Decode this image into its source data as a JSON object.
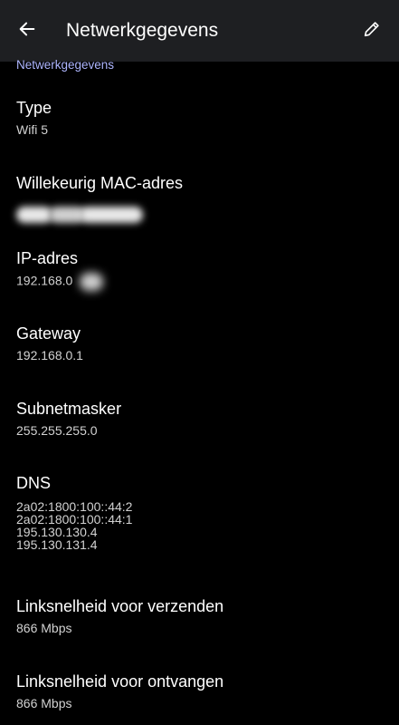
{
  "app_bar": {
    "title": "Netwerkgegevens",
    "back_icon": "arrow-left-icon",
    "edit_icon": "pencil-icon"
  },
  "section": {
    "header": "Netwerkgegevens"
  },
  "details": {
    "type": {
      "title": "Type",
      "value": "Wifi 5"
    },
    "mac": {
      "title": "Willekeurig MAC-adres"
    },
    "ip": {
      "title": "IP-adres",
      "value": "192.168.0"
    },
    "gateway": {
      "title": "Gateway",
      "value": "192.168.0.1"
    },
    "subnet": {
      "title": "Subnetmasker",
      "value": "255.255.255.0"
    },
    "dns": {
      "title": "DNS",
      "values": [
        "2a02:1800:100::44:2",
        "2a02:1800:100::44:1",
        "195.130.130.4",
        "195.130.131.4"
      ]
    },
    "tx_speed": {
      "title": "Linksnelheid voor verzenden",
      "value": "866 Mbps"
    },
    "rx_speed": {
      "title": "Linksnelheid voor ontvangen",
      "value": "866 Mbps"
    }
  },
  "colors": {
    "background": "#000000",
    "app_bar": "#1e1f22",
    "accent": "#aeb6ff",
    "secondary_text": "#d2d2d2"
  }
}
